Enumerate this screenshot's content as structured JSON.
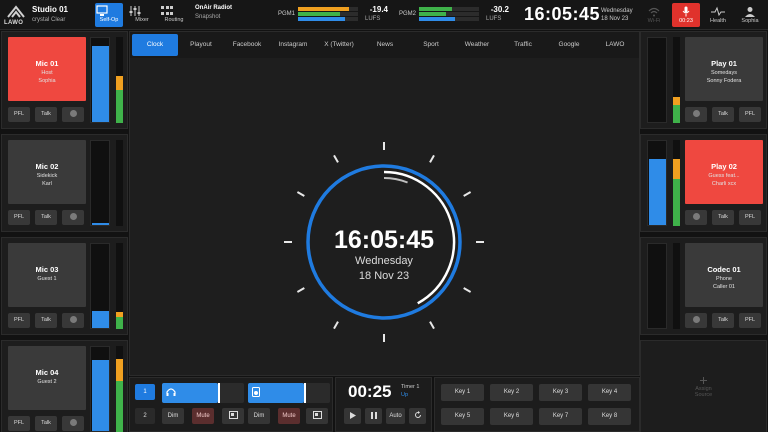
{
  "topbar": {
    "logo": "LAWO",
    "studio_title": "Studio 01",
    "studio_sub": "crystal Clear",
    "selfop": "Self-Op",
    "mixer": "Mixer",
    "routing": "Routing",
    "onair_title": "OnAir Radiot",
    "onair_sub": "Snapshot",
    "pgm1_label": "PGM1",
    "pgm1_value": "-19.4",
    "pgm1_unit": "LUFS",
    "pgm2_label": "PGM2",
    "pgm2_value": "-30.2",
    "pgm2_unit": "LUFS",
    "clock": "16:05:45",
    "day": "Wednesday",
    "date": "18 Nov 23",
    "wifi_label": "Wi-Fi",
    "timer_label": "00:23",
    "health": "Health",
    "user": "Sophia"
  },
  "left_channels": [
    {
      "name": "Mic 01",
      "line1": "Host",
      "line2": "Sophia",
      "live": true,
      "pfl": "PFL",
      "talk": "Talk",
      "level": 0.9,
      "side_level": 0.55
    },
    {
      "name": "Mic 02",
      "line1": "Sidekick",
      "line2": "Karl",
      "live": false,
      "pfl": "PFL",
      "talk": "Talk",
      "level": 0.02,
      "side_level": 0.0
    },
    {
      "name": "Mic 03",
      "line1": "Guest 1",
      "line2": "",
      "live": false,
      "pfl": "PFL",
      "talk": "Talk",
      "level": 0.2,
      "side_level": 0.2
    },
    {
      "name": "Mic 04",
      "line1": "Guest 2",
      "line2": "",
      "live": false,
      "pfl": "PFL",
      "talk": "Talk",
      "level": 0.85,
      "side_level": 0.85
    }
  ],
  "right_channels": [
    {
      "name": "Play 01",
      "line1": "Somedays",
      "line2": "Sonny Fodera",
      "live": false,
      "pfl": "PFL",
      "talk": "Talk",
      "level": 0.0,
      "side_level": 0.3
    },
    {
      "name": "Play 02",
      "line1": "Guess feat...",
      "line2": "Charli xcx",
      "live": true,
      "pfl": "PFL",
      "talk": "Talk",
      "level": 0.78,
      "side_level": 0.78
    },
    {
      "name": "Codec 01",
      "line1": "Phone",
      "line2": "Caller 01",
      "live": false,
      "pfl": "PFL",
      "talk": "Talk",
      "level": 0.0,
      "side_level": 0.0
    },
    {
      "name": "Assign",
      "line1": "Source",
      "line2": "",
      "live": false,
      "empty": true
    }
  ],
  "tabs": [
    "Clock",
    "Playout",
    "Facebook",
    "Instagram",
    "X (Twitter)",
    "News",
    "Sport",
    "Weather",
    "Traffic",
    "Google",
    "LAWO"
  ],
  "active_tab": "Clock",
  "bigclock": {
    "time": "16:05:45",
    "day": "Wednesday",
    "date": "18 Nov 23",
    "seconds_progress": 0.75
  },
  "bottom": {
    "headphone_1": "1",
    "headphone_2": "2",
    "dim": "Dim",
    "mute": "Mute",
    "timer": "00:25",
    "timer_label": "Timer 1",
    "timer_sub": "Up",
    "auto": "Auto",
    "keys": [
      "Key 1",
      "Key 2",
      "Key 3",
      "Key 4",
      "Key 5",
      "Key 6",
      "Key 7",
      "Key 8"
    ]
  },
  "colors": {
    "accent": "#1f7be0",
    "live_red": "#ef4840",
    "meter_blue": "#2f8ce8",
    "meter_green": "#3fb24a",
    "meter_orange": "#f0a020"
  }
}
